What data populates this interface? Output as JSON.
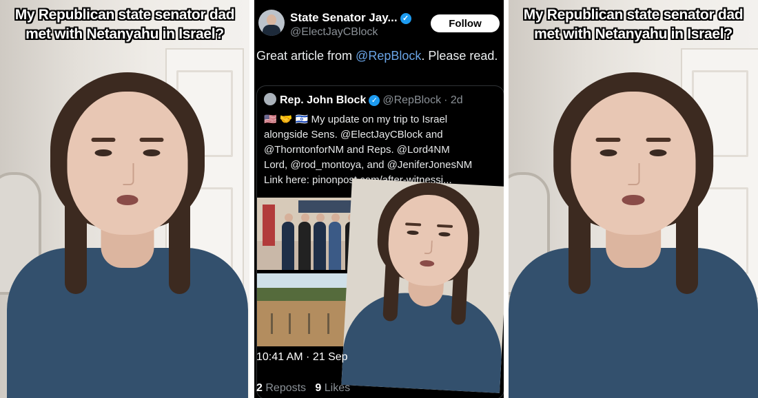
{
  "caption": {
    "line1": "My Republican state senator dad",
    "line2": "met with Netanyahu in Israel?"
  },
  "tweet": {
    "author_name": "State Senator Jay...",
    "author_handle": "@ElectJayCBlock",
    "follow_label": "Follow",
    "text_prefix": "Great article from ",
    "text_mention": "@RepBlock",
    "text_suffix": ". Please read.",
    "time": "10:41 AM · 21 Sep",
    "reposts_count": "2",
    "reposts_label": "Reposts",
    "likes_count": "9",
    "likes_label": "Likes",
    "icons": [
      "verified-icon"
    ]
  },
  "quoted": {
    "name": "Rep. John Block",
    "handle": "@RepBlock",
    "age": "· 2d",
    "text": "🇺🇸 🤝 🇮🇱 My update on my trip to Israel\nalongside Sens. @ElectJayCBlock and\n@ThorntonforNM and Reps. @Lord4NM\nLord, @rod_montoya, and @JeniferJonesNM\nLink here: pinonpost.com/after-witnessi..."
  },
  "colors": {
    "shirt": "#33506d",
    "hair": "#3c2a20",
    "mention": "#6aa4e6",
    "verified": "#1d9bf0"
  }
}
